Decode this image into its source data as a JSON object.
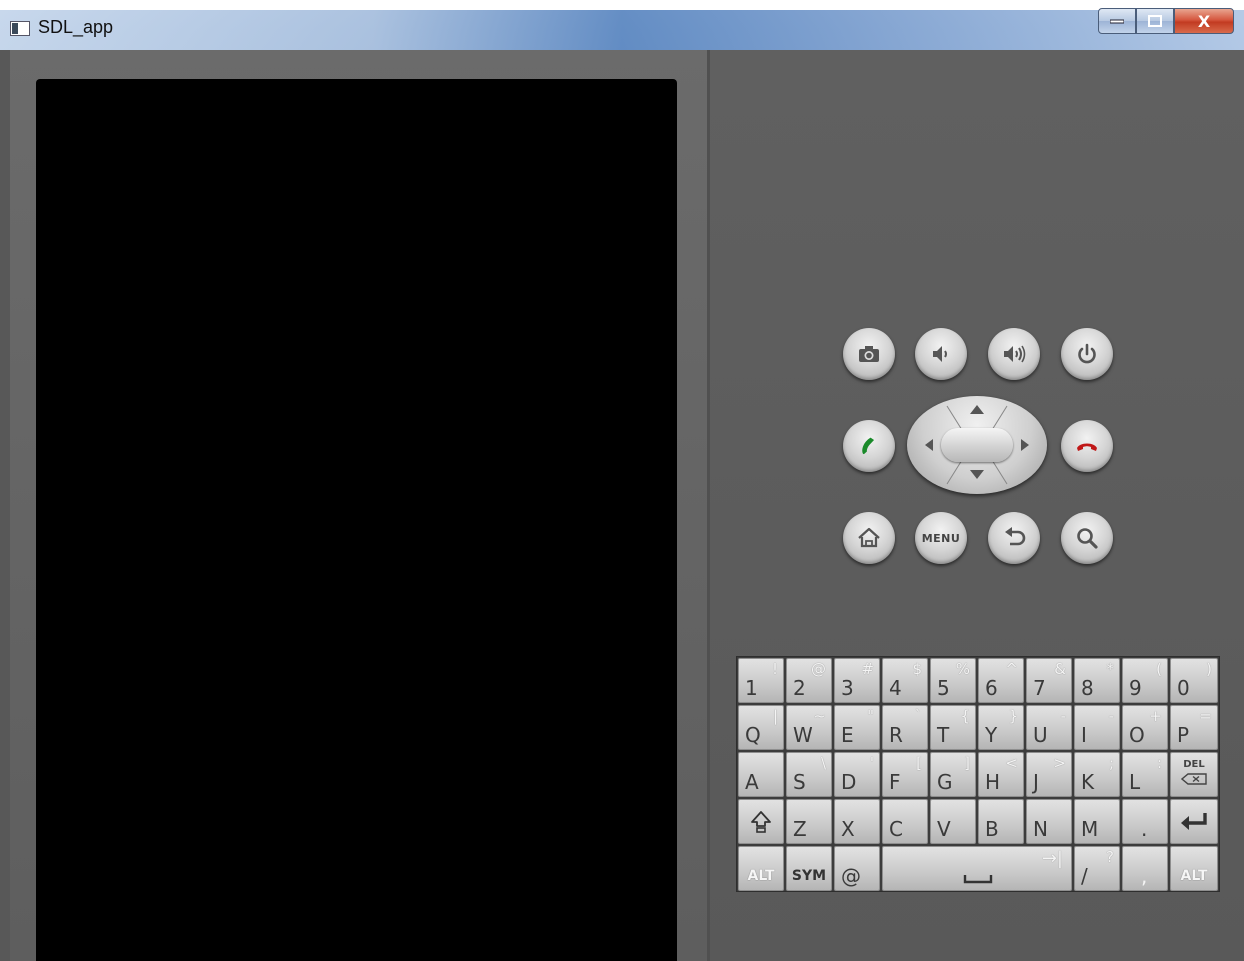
{
  "window": {
    "title": "SDL_app",
    "controls": {
      "minimize": "–",
      "maximize": "□",
      "close": "X"
    }
  },
  "hardware_buttons": {
    "row1": [
      {
        "icon": "camera-icon"
      },
      {
        "icon": "volume-down-icon"
      },
      {
        "icon": "volume-up-icon"
      },
      {
        "icon": "power-icon"
      }
    ],
    "row2": [
      {
        "icon": "call-icon",
        "color": "#1a8a2a"
      },
      {
        "icon": "dpad"
      },
      {
        "icon": "end-call-icon",
        "color": "#c01818"
      }
    ],
    "row3": [
      {
        "icon": "home-icon"
      },
      {
        "label": "MENU"
      },
      {
        "icon": "back-icon"
      },
      {
        "icon": "search-icon"
      }
    ]
  },
  "keyboard": {
    "row1": [
      {
        "main": "1",
        "alt": "!"
      },
      {
        "main": "2",
        "alt": "@"
      },
      {
        "main": "3",
        "alt": "#"
      },
      {
        "main": "4",
        "alt": "$"
      },
      {
        "main": "5",
        "alt": "%"
      },
      {
        "main": "6",
        "alt": "^"
      },
      {
        "main": "7",
        "alt": "&"
      },
      {
        "main": "8",
        "alt": "*"
      },
      {
        "main": "9",
        "alt": "("
      },
      {
        "main": "0",
        "alt": ")"
      }
    ],
    "row2": [
      {
        "main": "Q",
        "alt": "|"
      },
      {
        "main": "W",
        "alt": "~"
      },
      {
        "main": "E",
        "alt": "\""
      },
      {
        "main": "R",
        "alt": "`"
      },
      {
        "main": "T",
        "alt": "{"
      },
      {
        "main": "Y",
        "alt": "}"
      },
      {
        "main": "U",
        "alt": "-"
      },
      {
        "main": "I",
        "alt": "-"
      },
      {
        "main": "O",
        "alt": "+"
      },
      {
        "main": "P",
        "alt": "="
      }
    ],
    "row3": [
      {
        "main": "A",
        "alt": ""
      },
      {
        "main": "S",
        "alt": "\\"
      },
      {
        "main": "D",
        "alt": "'"
      },
      {
        "main": "F",
        "alt": "["
      },
      {
        "main": "G",
        "alt": "]"
      },
      {
        "main": "H",
        "alt": "<"
      },
      {
        "main": "J",
        "alt": ">"
      },
      {
        "main": "K",
        "alt": ";"
      },
      {
        "main": "L",
        "alt": ":"
      },
      {
        "main": "DEL",
        "alt": ""
      }
    ],
    "row4": [
      {
        "main": "",
        "alt": "",
        "icon": "shift-icon"
      },
      {
        "main": "Z",
        "alt": ""
      },
      {
        "main": "X",
        "alt": ""
      },
      {
        "main": "C",
        "alt": ""
      },
      {
        "main": "V",
        "alt": ""
      },
      {
        "main": "B",
        "alt": ""
      },
      {
        "main": "N",
        "alt": ""
      },
      {
        "main": "M",
        "alt": ""
      },
      {
        "main": ".",
        "alt": ""
      },
      {
        "main": "",
        "alt": "",
        "icon": "enter-icon"
      }
    ],
    "row5": {
      "alt_left": "ALT",
      "sym": "SYM",
      "at": "@",
      "space_tab": "→|",
      "slash": "/",
      "slash_alt": "?",
      "comma": ",",
      "alt_right": "ALT"
    }
  }
}
